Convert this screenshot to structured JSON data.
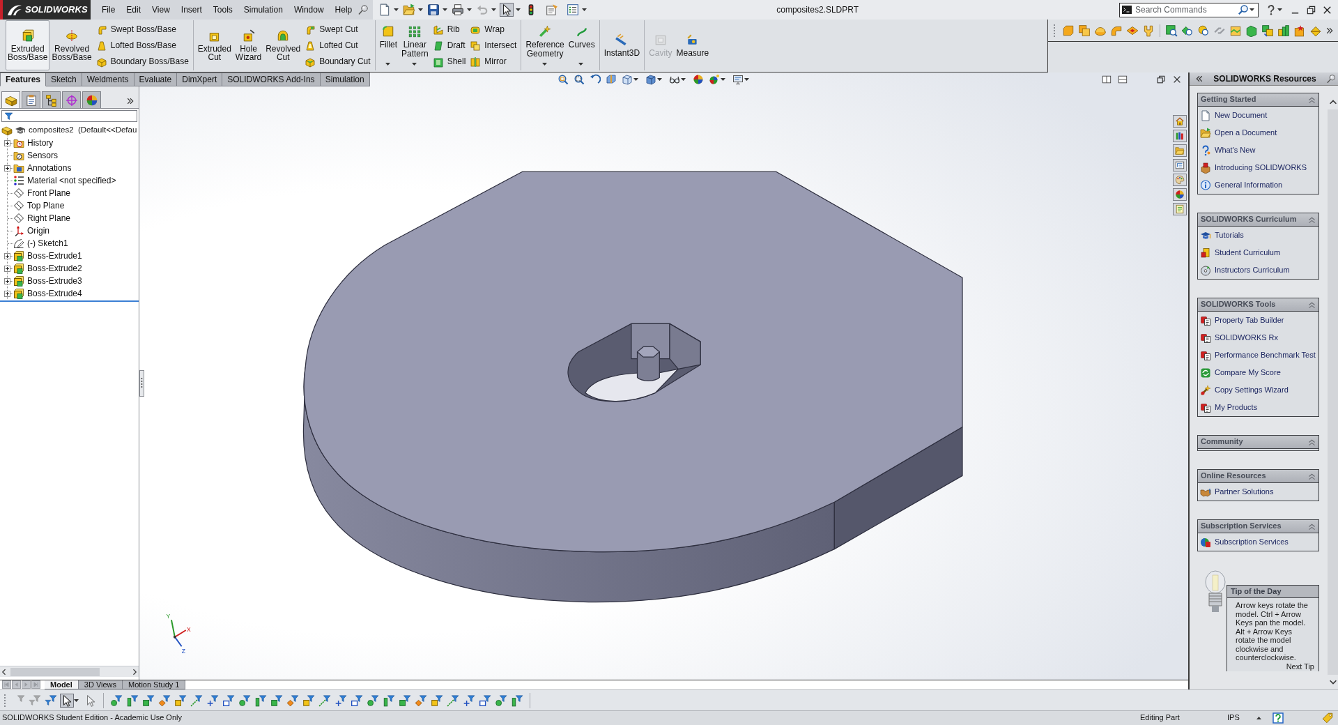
{
  "window": {
    "logo": "SOLIDWORKS",
    "title": "composites2.SLDPRT"
  },
  "menu": [
    "File",
    "Edit",
    "View",
    "Insert",
    "Tools",
    "Simulation",
    "Window",
    "Help"
  ],
  "quick_access": [
    {
      "pressed": false,
      "disabled": false
    },
    {
      "pressed": false,
      "disabled": false
    },
    {
      "pressed": false,
      "disabled": false
    },
    {
      "pressed": false,
      "disabled": false
    },
    {
      "pressed": false,
      "disabled": true
    },
    {
      "pressed": true,
      "disabled": false
    },
    {
      "pressed": false,
      "disabled": false
    },
    {
      "pressed": false,
      "disabled": false
    },
    {
      "pressed": false,
      "disabled": false
    }
  ],
  "search": {
    "placeholder": "Search Commands"
  },
  "command_groups": [
    {
      "items": [
        {
          "kind": "large",
          "label": "Extruded Boss/Base",
          "highlighted": true,
          "dropdown": false,
          "disabled": false
        },
        {
          "kind": "large",
          "label": "Revolved Boss/Base",
          "highlighted": false,
          "dropdown": false,
          "disabled": false
        },
        {
          "kind": "stack",
          "entries": [
            "Swept Boss/Base",
            "Lofted Boss/Base",
            "Boundary Boss/Base"
          ]
        }
      ]
    },
    {
      "items": [
        {
          "kind": "large",
          "label": "Extruded Cut",
          "highlighted": false,
          "dropdown": false,
          "disabled": false
        },
        {
          "kind": "large",
          "label": "Hole Wizard",
          "highlighted": false,
          "dropdown": false,
          "disabled": false
        },
        {
          "kind": "large",
          "label": "Revolved Cut",
          "highlighted": false,
          "dropdown": false,
          "disabled": false
        },
        {
          "kind": "stack",
          "entries": [
            "Swept Cut",
            "Lofted Cut",
            "Boundary Cut"
          ]
        }
      ]
    },
    {
      "items": [
        {
          "kind": "large",
          "label": "Fillet",
          "highlighted": false,
          "dropdown": true,
          "disabled": false
        },
        {
          "kind": "large",
          "label": "Linear Pattern",
          "highlighted": false,
          "dropdown": true,
          "disabled": false
        },
        {
          "kind": "stack",
          "entries": [
            "Rib",
            "Draft",
            "Shell"
          ]
        },
        {
          "kind": "stack",
          "entries": [
            "Wrap",
            "Intersect",
            "Mirror"
          ]
        }
      ]
    },
    {
      "items": [
        {
          "kind": "large",
          "label": "Reference Geometry",
          "highlighted": false,
          "dropdown": true,
          "disabled": false
        },
        {
          "kind": "large",
          "label": "Curves",
          "highlighted": false,
          "dropdown": true,
          "disabled": false
        }
      ]
    },
    {
      "items": [
        {
          "kind": "large",
          "label": "Instant3D",
          "highlighted": false,
          "dropdown": false,
          "disabled": false
        }
      ]
    },
    {
      "items": [
        {
          "kind": "large",
          "label": "Cavity",
          "highlighted": false,
          "dropdown": false,
          "disabled": true
        },
        {
          "kind": "large",
          "label": "Measure",
          "highlighted": false,
          "dropdown": false,
          "disabled": false
        }
      ]
    }
  ],
  "tabs": [
    {
      "label": "Features",
      "selected": true
    },
    {
      "label": "Sketch",
      "selected": false
    },
    {
      "label": "Weldments",
      "selected": false
    },
    {
      "label": "Evaluate",
      "selected": false
    },
    {
      "label": "DimXpert",
      "selected": false
    },
    {
      "label": "SOLIDWORKS Add-Ins",
      "selected": false
    },
    {
      "label": "Simulation",
      "selected": false
    }
  ],
  "manager_tabs": [
    {
      "selected": true
    },
    {
      "selected": false
    },
    {
      "selected": false
    },
    {
      "selected": false
    },
    {
      "selected": false
    }
  ],
  "feature_tree": [
    {
      "label": "composites2  (Default<<Defau",
      "kind": "part",
      "expandable": false,
      "children": [
        {
          "label": "History",
          "kind": "history",
          "expandable": true
        },
        {
          "label": "Sensors",
          "kind": "sensors",
          "expandable": false
        },
        {
          "label": "Annotations",
          "kind": "annotations",
          "expandable": true
        },
        {
          "label": "Material <not specified>",
          "kind": "material",
          "expandable": false
        },
        {
          "label": "Front Plane",
          "kind": "plane",
          "expandable": false
        },
        {
          "label": "Top Plane",
          "kind": "plane",
          "expandable": false
        },
        {
          "label": "Right Plane",
          "kind": "plane",
          "expandable": false
        },
        {
          "label": "Origin",
          "kind": "origin",
          "expandable": false
        },
        {
          "label": "(-) Sketch1",
          "kind": "sketch",
          "expandable": false
        },
        {
          "label": "Boss-Extrude1",
          "kind": "feature",
          "expandable": true
        },
        {
          "label": "Boss-Extrude2",
          "kind": "feature",
          "expandable": true
        },
        {
          "label": "Boss-Extrude3",
          "kind": "feature",
          "expandable": true
        },
        {
          "label": "Boss-Extrude4",
          "kind": "feature",
          "expandable": true
        }
      ]
    }
  ],
  "triad": [
    "Y",
    "X",
    "Z"
  ],
  "bottom_tabs": [
    {
      "label": "Model",
      "selected": true
    },
    {
      "label": "3D Views",
      "selected": false
    },
    {
      "label": "Motion Study 1",
      "selected": false
    }
  ],
  "selection_tools": [
    {
      "pressed": false,
      "disabled": true
    },
    {
      "pressed": false,
      "disabled": true
    },
    {
      "pressed": false,
      "disabled": false
    },
    {
      "pressed": true,
      "disabled": false
    },
    {
      "pressed": false,
      "disabled": true
    }
  ],
  "resources": {
    "title": "SOLIDWORKS Resources",
    "sections": [
      {
        "title": "Getting Started",
        "items": [
          "New Document",
          "Open a Document",
          "What's New",
          "Introducing SOLIDWORKS",
          "General Information"
        ]
      },
      {
        "title": "SOLIDWORKS Curriculum",
        "items": [
          "Tutorials",
          "Student Curriculum",
          "Instructors Curriculum"
        ]
      },
      {
        "title": "SOLIDWORKS Tools",
        "items": [
          "Property Tab Builder",
          "SOLIDWORKS Rx",
          "Performance Benchmark Test",
          "Compare My Score",
          "Copy Settings Wizard",
          "My Products"
        ]
      },
      {
        "title": "Community"
      },
      {
        "title": "Online Resources",
        "items": [
          "Partner Solutions"
        ]
      },
      {
        "title": "Subscription Services",
        "items": [
          "Subscription Services"
        ]
      }
    ]
  },
  "tip": {
    "title": "Tip of the Day",
    "text": "Arrow keys rotate the model. Ctrl + Arrow Keys pan the model. Alt + Arrow Keys rotate the model clockwise and counterclockwise.",
    "link": "Next Tip"
  },
  "status_bar": {
    "edition": "SOLIDWORKS Student Edition - Academic Use Only",
    "mode": "Editing Part",
    "units": "IPS"
  }
}
